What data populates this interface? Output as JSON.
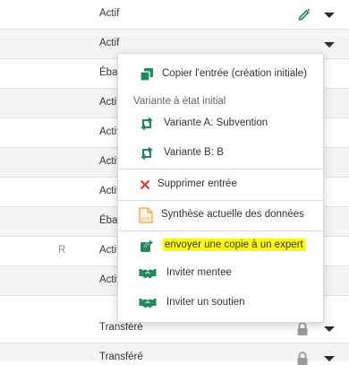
{
  "rows": [
    {
      "status": "Actif",
      "r": "",
      "icon": "pencil-icon",
      "alt": false
    },
    {
      "status": "Actif",
      "r": "",
      "icon": "",
      "alt": true
    },
    {
      "status": "Ébauche",
      "r": "",
      "icon": "",
      "alt": false
    },
    {
      "status": "Actif",
      "r": "",
      "icon": "",
      "alt": true
    },
    {
      "status": "Actif",
      "r": "",
      "icon": "",
      "alt": false
    },
    {
      "status": "Actif",
      "r": "",
      "icon": "",
      "alt": true
    },
    {
      "status": "Actif",
      "r": "",
      "icon": "",
      "alt": false
    },
    {
      "status": "Ébauche",
      "r": "",
      "icon": "",
      "alt": true
    },
    {
      "status": "Actif",
      "r": "R",
      "icon": "",
      "alt": false
    },
    {
      "status": "Actif",
      "r": "",
      "icon": "",
      "alt": true
    },
    {
      "status": "Transféré",
      "r": "",
      "icon": "lock-icon",
      "alt": false
    },
    {
      "status": "Transféré",
      "r": "",
      "icon": "lock-icon",
      "alt": true
    }
  ],
  "menu": {
    "copy_entry": "Copier l'entrée (création initiale)",
    "variant_section": "Variante à état initial",
    "variant_a": "Variante A: Subvention",
    "variant_b": "Variante B: B",
    "delete_entry": "Supprimer entrée",
    "data_summary": "Synthèse actuelle des données",
    "pdf_badge": "PDF",
    "send_copy_expert": "envoyer une copie à un expert",
    "invite_mentee": "Inviter mentee",
    "invite_support": "Inviter un soutien"
  },
  "colors": {
    "green_accent": "#1f8a5b",
    "delete_red": "#d9362b",
    "pdf_orange": "#f2a23a",
    "highlight_yellow": "#ffff00"
  }
}
